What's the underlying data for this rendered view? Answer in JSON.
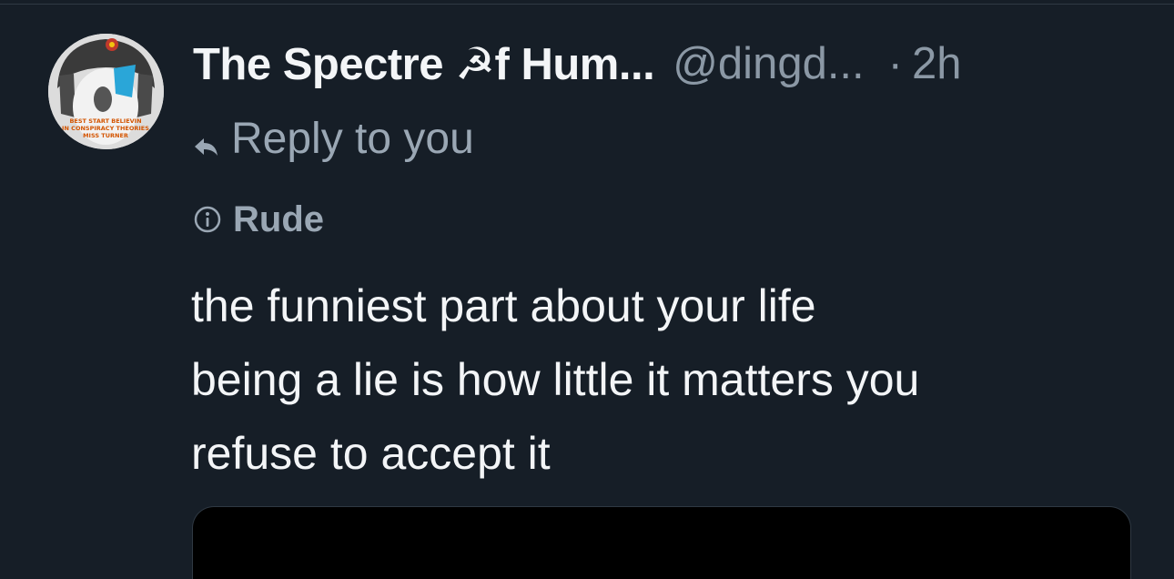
{
  "post": {
    "author": {
      "display_name": "The Spectre ☭f Hum...",
      "handle": "@dingd...",
      "avatar_caption": [
        "BEST START BELIEVIN",
        "IN CONSPIRACY THEORIES",
        "MISS TURNER"
      ]
    },
    "separator": "·",
    "time": "2h",
    "reply_context": "Reply to you",
    "content_label": "Rude",
    "text_lines": [
      "the funniest part about your life",
      "being a lie is how little it matters you",
      "refuse to accept it"
    ]
  },
  "icons": {
    "reply": "reply-arrow-icon",
    "label": "info-circle-icon"
  },
  "colors": {
    "background": "#161e27",
    "primary_text": "#f3f5f7",
    "secondary_text": "#8b98a5",
    "divider": "#2f3943"
  }
}
